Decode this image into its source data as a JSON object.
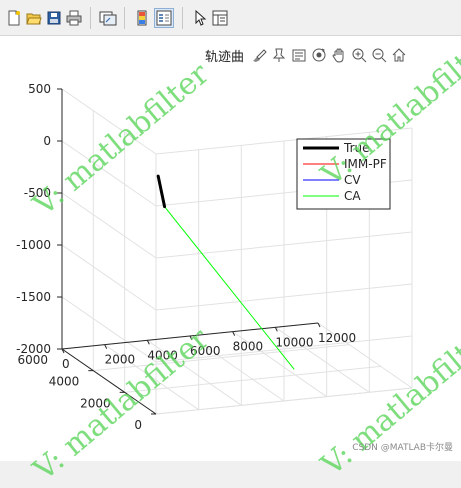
{
  "toolbar": {
    "buttons": [
      {
        "icon": "new-figure-icon"
      },
      {
        "icon": "open-file-icon"
      },
      {
        "icon": "save-icon"
      },
      {
        "icon": "print-icon"
      },
      {
        "icon": "link-plot-icon"
      },
      {
        "icon": "insert-colorbar-icon"
      },
      {
        "icon": "insert-legend-icon",
        "active": true
      },
      {
        "icon": "edit-plot-arrow-icon"
      },
      {
        "icon": "property-inspector-icon"
      }
    ]
  },
  "axes_toolbar": {
    "title": "轨迹曲",
    "icons": [
      "brush-icon",
      "datatip-icon",
      "pan-legend-icon",
      "rotate-icon",
      "pan-hand-icon",
      "zoom-in-icon",
      "zoom-out-icon",
      "home-icon"
    ]
  },
  "chart_data": {
    "type": "line",
    "projection": "3d",
    "title": "",
    "xlabel": "",
    "ylabel": "",
    "zlabel": "",
    "xlim": [
      0,
      12000
    ],
    "ylim": [
      0,
      6000
    ],
    "zlim": [
      -2000,
      500
    ],
    "xticks": [
      0,
      2000,
      4000,
      6000,
      8000,
      10000,
      12000
    ],
    "yticks": [
      0,
      2000,
      4000,
      6000
    ],
    "zticks": [
      500,
      0,
      -500,
      -1000,
      -1500,
      -2000
    ],
    "xtick_labels": [
      "0",
      "2000",
      "4000",
      "6000",
      "8000",
      "10000",
      "12000"
    ],
    "ytick_labels": [
      "0",
      "2000",
      "4000",
      "6000"
    ],
    "ztick_labels": [
      "500",
      "0",
      "-500",
      "-1000",
      "-1500",
      "-2000"
    ],
    "grid": true,
    "legend_position": "top-right",
    "series": [
      {
        "name": "True",
        "color": "#000000",
        "width": 3,
        "x": [
          4000,
          3700
        ],
        "y": [
          4900,
          4900
        ],
        "z": [
          -600,
          -300
        ]
      },
      {
        "name": "IMM-PF",
        "color": "#ff0000",
        "width": 1,
        "x": [
          4000,
          3700
        ],
        "y": [
          4900,
          4900
        ],
        "z": [
          -600,
          -300
        ]
      },
      {
        "name": "CV",
        "color": "#0000ff",
        "width": 1,
        "x": [
          4000,
          3800
        ],
        "y": [
          4900,
          4900
        ],
        "z": [
          -600,
          -400
        ]
      },
      {
        "name": "CA",
        "color": "#00ff00",
        "width": 1,
        "x": [
          4000,
          8300
        ],
        "y": [
          4900,
          2500
        ],
        "z": [
          -600,
          -2000
        ]
      }
    ]
  },
  "watermark": "V: matlabfilter",
  "credit": "CSDN @MATLAB卡尔曼"
}
